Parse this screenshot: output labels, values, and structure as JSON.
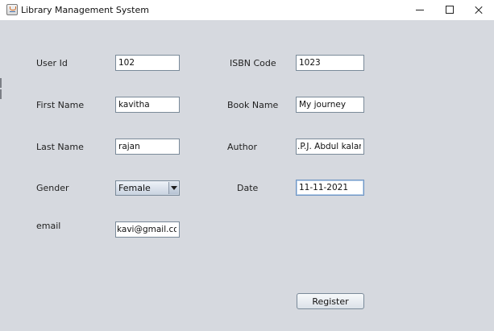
{
  "window": {
    "title": "Library Management System",
    "icon": "java-cup-icon",
    "controls": [
      "minimize-icon",
      "maximize-icon",
      "close-icon"
    ]
  },
  "form": {
    "user_id": {
      "label": "User Id",
      "value": "102"
    },
    "first_name": {
      "label": "First Name",
      "value": "kavitha"
    },
    "last_name": {
      "label": "Last Name",
      "value": "rajan"
    },
    "gender": {
      "label": "Gender",
      "selected": "Female"
    },
    "email": {
      "label": "email",
      "value": "kavi@gmail.com"
    },
    "isbn_code": {
      "label": "ISBN Code",
      "value": "1023"
    },
    "book_name": {
      "label": "Book Name",
      "value": "My journey"
    },
    "author": {
      "label": "Author",
      "value": ".P.J. Abdul kalam"
    },
    "date": {
      "label": "Date",
      "value": "11-11-2021"
    },
    "register_label": "Register"
  },
  "colors": {
    "window_background": "#d6d9df",
    "field_border": "#7a8a99",
    "focus_border": "#6f95c4"
  }
}
